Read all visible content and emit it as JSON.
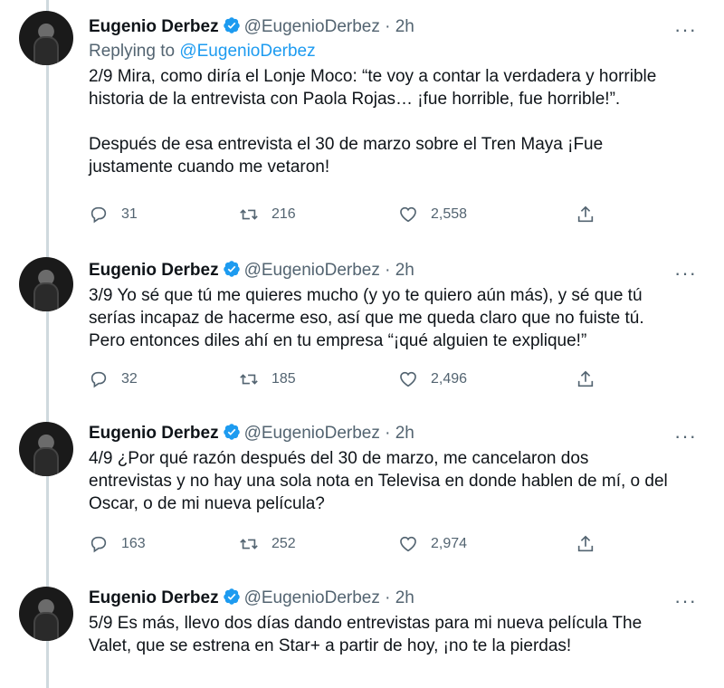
{
  "tweets": [
    {
      "name": "Eugenio Derbez",
      "handle": "@EugenioDerbez",
      "separator": "·",
      "time": "2h",
      "replying_prefix": "Replying to ",
      "replying_to": "@EugenioDerbez",
      "text": "2/9 Mira, como diría el Lonje Moco: “te voy a contar la verdadera y horrible\nhistoria de la entrevista con Paola Rojas… ¡fue horrible, fue horrible!”.\n\nDespués de esa entrevista el 30 de marzo sobre el Tren Maya ¡Fue\njustamente cuando me vetaron!",
      "replies": "31",
      "retweets": "216",
      "likes": "2,558"
    },
    {
      "name": "Eugenio Derbez",
      "handle": "@EugenioDerbez",
      "separator": "·",
      "time": "2h",
      "text": "3/9 Yo sé que tú me quieres mucho (y yo te quiero aún más), y sé que tú\nserías incapaz de hacerme eso, así que me queda claro que no fuiste tú.\nPero entonces diles ahí en tu empresa “¡qué alguien te explique!”",
      "replies": "32",
      "retweets": "185",
      "likes": "2,496"
    },
    {
      "name": "Eugenio Derbez",
      "handle": "@EugenioDerbez",
      "separator": "·",
      "time": "2h",
      "text": "4/9 ¿Por qué razón después del 30 de marzo, me cancelaron dos\nentrevistas y no hay una sola nota en Televisa en donde hablen de mí, o del\nOscar, o de mi nueva película?",
      "replies": "163",
      "retweets": "252",
      "likes": "2,974"
    },
    {
      "name": "Eugenio Derbez",
      "handle": "@EugenioDerbez",
      "separator": "·",
      "time": "2h",
      "text": "5/9 Es más, llevo dos días dando entrevistas para mi nueva película The\nValet, que se estrena en Star+ a partir de hoy, ¡no te la pierdas!"
    }
  ],
  "more_label": "···",
  "colors": {
    "link": "#1d9bf0",
    "muted": "#536471",
    "verified": "#1d9bf0",
    "thread_line": "#cfd9de"
  }
}
